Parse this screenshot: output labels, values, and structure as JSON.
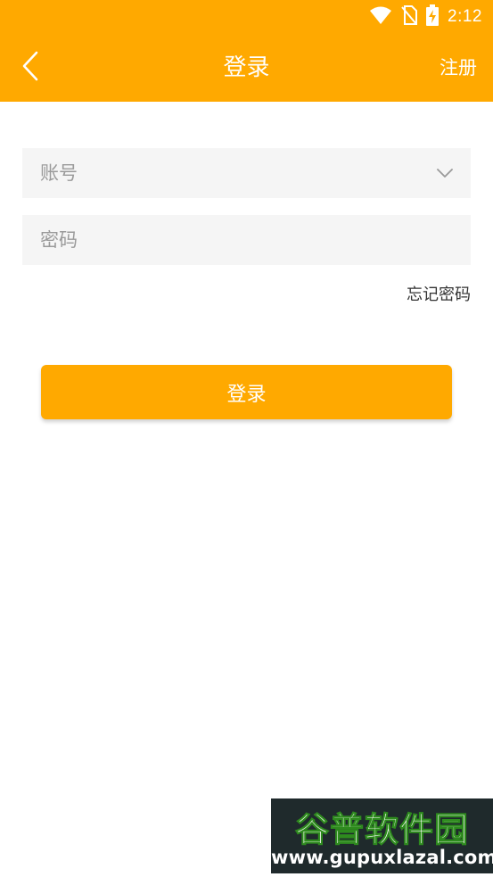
{
  "status_bar": {
    "time": "2:12",
    "icons": [
      "wifi-icon",
      "no-sim-icon",
      "battery-charging-icon"
    ]
  },
  "app_bar": {
    "title": "登录",
    "back_icon": "chevron-left-icon",
    "register_label": "注册"
  },
  "form": {
    "account": {
      "placeholder": "账号",
      "value": "",
      "dropdown_icon": "chevron-down-icon"
    },
    "password": {
      "placeholder": "密码",
      "value": ""
    },
    "forgot_label": "忘记密码",
    "login_label": "登录"
  },
  "watermark": {
    "name": "谷普软件园",
    "url": "www.gupuxlazal.com"
  },
  "colors": {
    "accent": "#FFA900",
    "field_bg": "#F5F5F5",
    "placeholder": "#9A9A9A",
    "text": "#333333"
  }
}
